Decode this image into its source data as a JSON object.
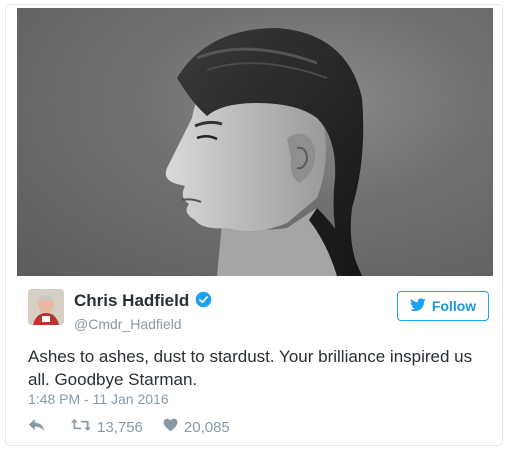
{
  "tweet": {
    "author_name": "Chris Hadfield",
    "handle": "@Cmdr_Hadfield",
    "follow_label": "Follow",
    "text": "Ashes to ashes, dust to stardust. Your brilliance inspired us all. Goodbye Starman.",
    "timestamp": "1:48 PM - 11 Jan 2016",
    "retweets": "13,756",
    "likes": "20,085"
  },
  "icons": {
    "verified": "verified-badge-icon",
    "bird": "twitter-bird-icon",
    "reply": "reply-arrow-icon",
    "retweet": "retweet-icon",
    "like": "heart-icon"
  },
  "colors": {
    "accent": "#1da1f2",
    "follow_text": "#1b95e0",
    "text_primary": "#292f33",
    "text_secondary": "#8899a6",
    "border": "#e1e8ed"
  }
}
